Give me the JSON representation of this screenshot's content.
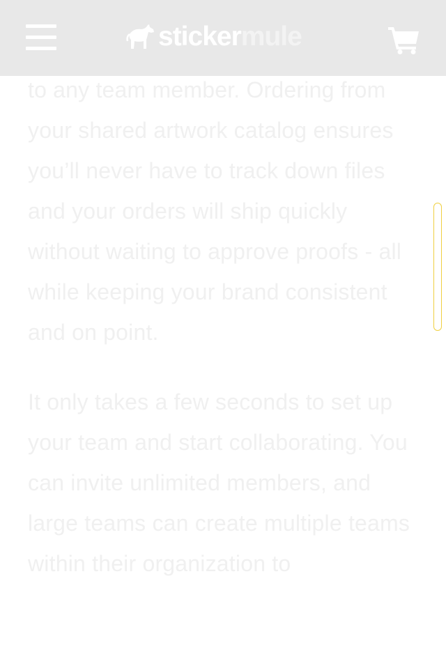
{
  "header": {
    "logo_part1": "sticker",
    "logo_part2": "mule",
    "menu_icon": "hamburger-menu-icon",
    "cart_icon": "shopping-cart-icon",
    "background": "#e8e8e8"
  },
  "content": {
    "paragraph1": "to any team member. Ordering from your shared artwork catalog ensures you’ll never have to track down files and your orders will ship quickly without waiting to approve proofs - all while keeping your brand consistent and on point.",
    "paragraph2": "It only takes a few seconds to set up your team and start collaborating. You can invite unlimited members, and large teams can create multiple teams within their organization to"
  },
  "colors": {
    "text": "#f0f0f0",
    "scrollbar_border": "#f0d040"
  }
}
